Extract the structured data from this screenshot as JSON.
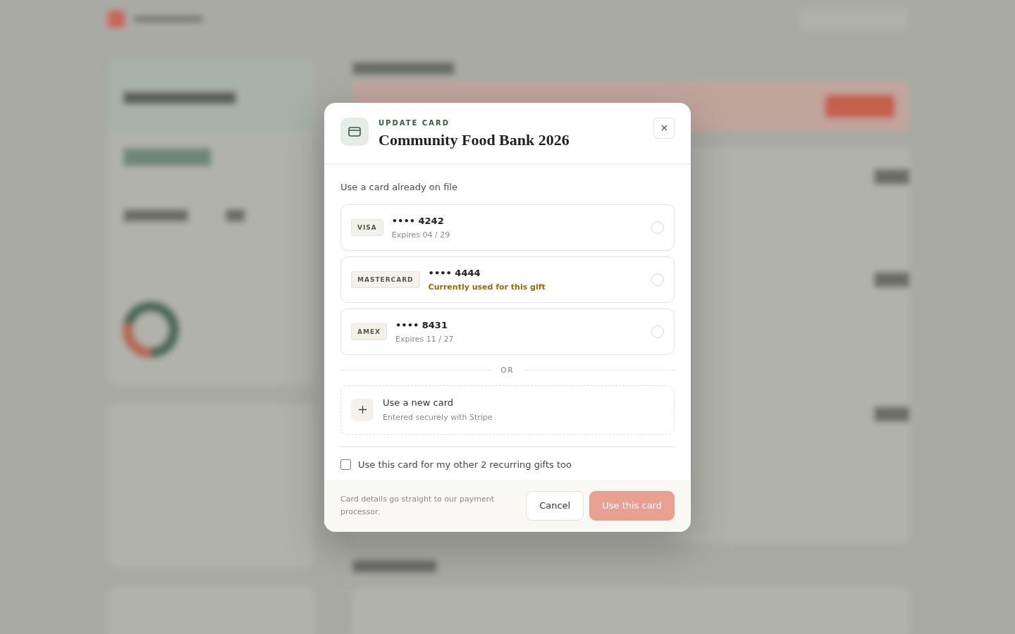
{
  "dialog": {
    "eyebrow": "UPDATE CARD",
    "title": "Community Food Bank 2026",
    "section_label": "Use a card already on file",
    "cards": [
      {
        "brand": "VISA",
        "number": "•••• 4242",
        "detail": "Expires 04 / 29",
        "kind": "expiry",
        "selected": false
      },
      {
        "brand": "MASTERCARD",
        "number": "•••• 4444",
        "detail": "Currently used for this gift",
        "kind": "current",
        "selected": false
      },
      {
        "brand": "AMEX",
        "number": "•••• 8431",
        "detail": "Expires 11 / 27",
        "kind": "expiry",
        "selected": false
      }
    ],
    "divider_label": "OR",
    "new_card": {
      "title": "Use a new card",
      "subtitle": "Entered securely with Stripe"
    },
    "apply_to_all": {
      "label": "Use this card for my other 2 recurring gifts too",
      "checked": false
    },
    "footer_note": "Card details go straight to our payment processor.",
    "buttons": [
      {
        "label": "Cancel",
        "kind": "secondary",
        "disabled": false
      },
      {
        "label": "Use this card",
        "kind": "primary",
        "disabled": true
      }
    ]
  }
}
